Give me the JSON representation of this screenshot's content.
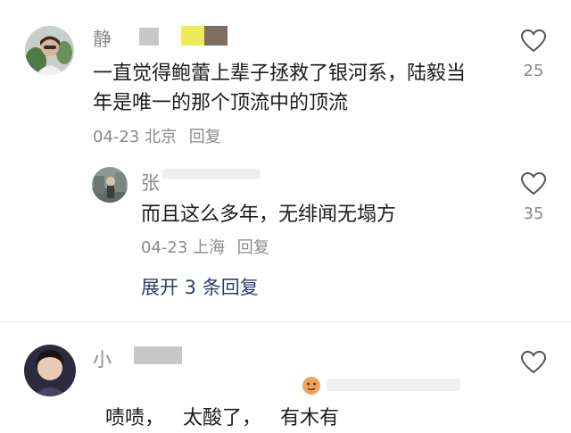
{
  "comments": [
    {
      "author": "静",
      "text_line1": "一直觉得鲍蕾上辈子拯救了银河系，陆毅当",
      "text_line2": "年是唯一的那个顶流中的顶流",
      "date": "04-23",
      "location": "北京",
      "reply_label": "回复",
      "likes": "25"
    },
    {
      "author": "张",
      "text": "而且这么多年，无绯闻无塌方",
      "date": "04-23",
      "location": "上海",
      "reply_label": "回复",
      "likes": "35"
    },
    {
      "author": "小",
      "text": "啧啧，   太酸了，   有木有"
    }
  ],
  "expand_replies_label": "展开 3 条回复",
  "icons": {
    "like": "heart-outline-icon",
    "emoji": "emoji-face-icon"
  },
  "colors": {
    "name_gray": "#8a8a8a",
    "text_dark": "#1c1c1c",
    "link_blue": "#2c3e6b",
    "divider": "#eeeeee"
  }
}
